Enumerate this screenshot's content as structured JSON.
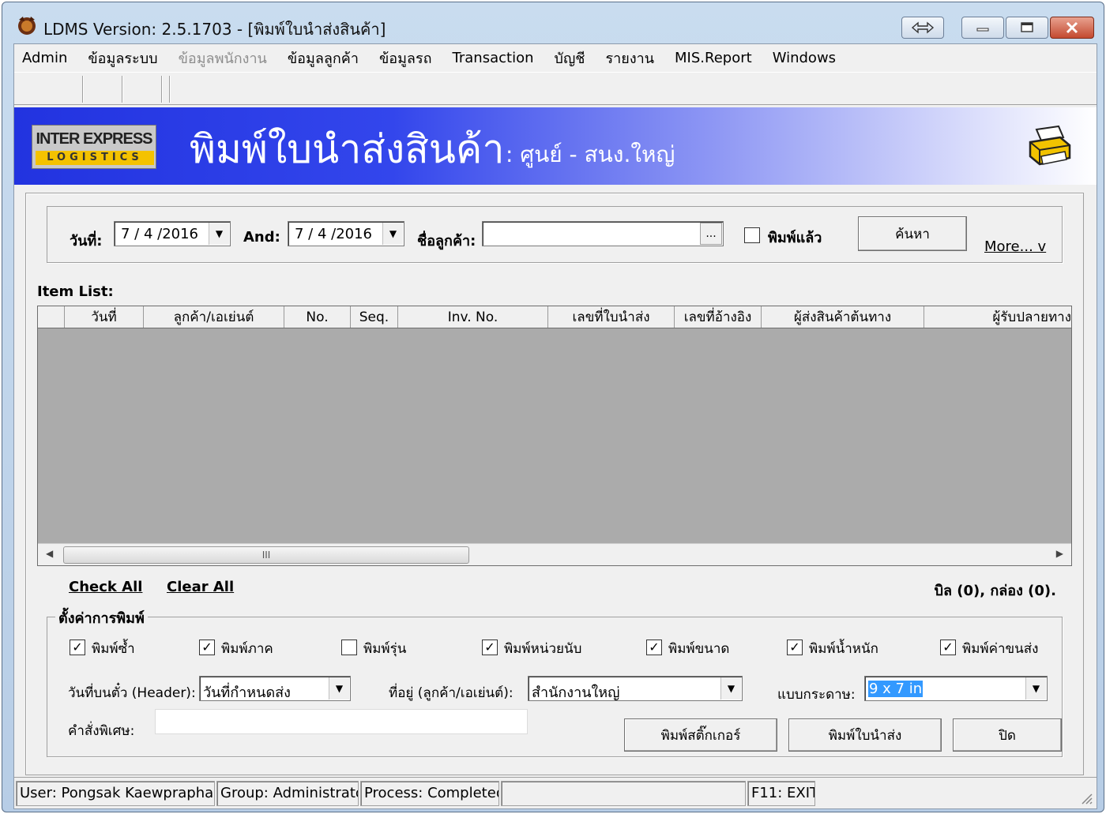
{
  "window": {
    "title": "LDMS Version: 2.5.1703 - [พิมพ์ใบนำส่งสินค้า]"
  },
  "menu": [
    {
      "label": "Admin",
      "disabled": false
    },
    {
      "label": "ข้อมูลระบบ",
      "disabled": false
    },
    {
      "label": "ข้อมูลพนักงาน",
      "disabled": true
    },
    {
      "label": "ข้อมูลลูกค้า",
      "disabled": false
    },
    {
      "label": "ข้อมูลรถ",
      "disabled": false
    },
    {
      "label": "Transaction",
      "disabled": false
    },
    {
      "label": "บัญชี",
      "disabled": false
    },
    {
      "label": "รายงาน",
      "disabled": false
    },
    {
      "label": "MIS.Report",
      "disabled": false
    },
    {
      "label": "Windows",
      "disabled": false
    }
  ],
  "banner": {
    "logo_top": "INTER EXPRESS",
    "logo_bottom": "LOGISTICS",
    "title": "พิมพ์ใบนำส่งสินค้า",
    "subtitle": ": ศูนย์ - สนง.ใหญ่",
    "icon": "printer-icon"
  },
  "search": {
    "date_label": "วันที่:",
    "date_from": "7 / 4 /2016",
    "and_label": "And:",
    "date_to": "7 / 4 /2016",
    "customer_label": "ชื่อลูกค้า:",
    "customer_value": "",
    "ellipsis": "...",
    "printed_label": "พิมพ์แล้ว",
    "printed_checked": false,
    "search_button": "ค้นหา",
    "more_link": "More... v"
  },
  "items": {
    "label": "Item List:",
    "columns": [
      "",
      "วันที่",
      "ลูกค้า/เอเย่นต์",
      "No.",
      "Seq.",
      "Inv. No.",
      "เลขที่ใบนำส่ง",
      "เลขที่อ้างอิง",
      "ผู้ส่งสินค้าต้นทาง",
      "ผู้รับปลายทาง"
    ],
    "rows": [],
    "scroll_thumb": "III"
  },
  "actions": {
    "check_all": "Check All",
    "clear_all": "Clear All",
    "summary": "บิล (0), กล่อง (0)."
  },
  "settings": {
    "legend": "ตั้งค่าการพิมพ์",
    "options": [
      {
        "label": "พิมพ์ซ้ำ",
        "checked": true
      },
      {
        "label": "พิมพ์ภาค",
        "checked": true
      },
      {
        "label": "พิมพ์รุ่น",
        "checked": false
      },
      {
        "label": "พิมพ์หน่วยนับ",
        "checked": true
      },
      {
        "label": "พิมพ์ขนาด",
        "checked": true
      },
      {
        "label": "พิมพ์น้ำหนัก",
        "checked": true
      },
      {
        "label": "พิมพ์ค่าขนส่ง",
        "checked": true
      }
    ],
    "header_date_label": "วันที่บนตั๋ว (Header):",
    "header_date_value": "วันที่กำหนดส่ง",
    "address_label": "ที่อยู่ (ลูกค้า/เอเย่นต์):",
    "address_value": "สำนักงานใหญ่",
    "paper_label": "แบบกระดาษ:",
    "paper_value": "9 x 7 in",
    "special_label": "คำสั่งพิเศษ:",
    "special_value": "",
    "sticker_button": "พิมพ์สติ๊กเกอร์",
    "print_button": "พิมพ์ใบนำส่ง",
    "close_button": "ปิด"
  },
  "status": {
    "user": "User: Pongsak  Kaewpraphan",
    "group": "Group: Administrators",
    "process": "Process: Completed.",
    "empty": "",
    "exit": "F11: EXIT"
  }
}
